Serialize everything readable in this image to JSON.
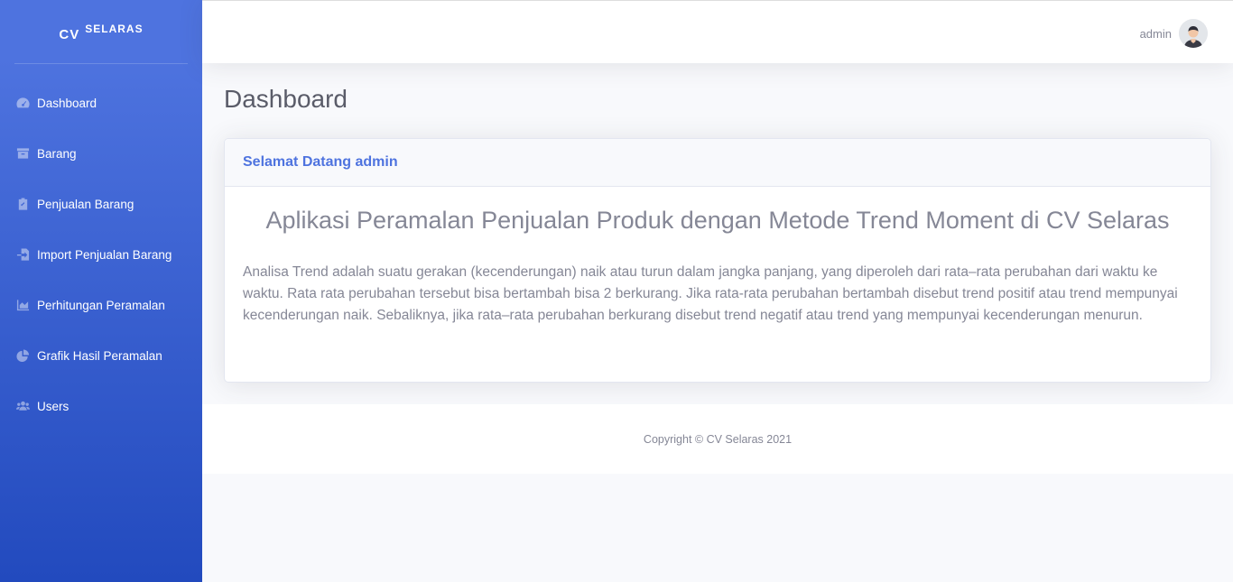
{
  "brand": {
    "prefix": "CV",
    "name": "SELARAS"
  },
  "sidebar": {
    "items": [
      {
        "label": "Dashboard",
        "icon": "tachometer-icon"
      },
      {
        "label": "Barang",
        "icon": "box-icon"
      },
      {
        "label": "Penjualan Barang",
        "icon": "clipboard-check-icon"
      },
      {
        "label": "Import Penjualan Barang",
        "icon": "file-import-icon"
      },
      {
        "label": "Perhitungan Peramalan",
        "icon": "chart-area-icon"
      },
      {
        "label": "Grafik Hasil Peramalan",
        "icon": "chart-pie-icon"
      },
      {
        "label": "Users",
        "icon": "users-icon"
      }
    ]
  },
  "topbar": {
    "username": "admin"
  },
  "page": {
    "title": "Dashboard"
  },
  "card": {
    "header": "Selamat Datang admin",
    "heading": "Aplikasi Peramalan Penjualan Produk dengan Metode Trend Moment di CV Selaras",
    "body": "Analisa Trend adalah suatu gerakan (kecenderungan) naik atau turun dalam jangka panjang, yang diperoleh dari rata–rata perubahan dari waktu ke waktu. Rata rata perubahan tersebut bisa bertambah bisa 2 berkurang. Jika rata-rata perubahan bertambah disebut trend positif atau trend mempunyai kecenderungan naik. Sebaliknya, jika rata–rata perubahan berkurang disebut trend negatif atau trend yang mempunyai kecenderungan menurun."
  },
  "footer": {
    "copyright": "Copyright © CV Selaras 2021"
  },
  "colors": {
    "primary": "#4e73df",
    "primary_dark": "#224abe",
    "text_muted": "#858796"
  }
}
